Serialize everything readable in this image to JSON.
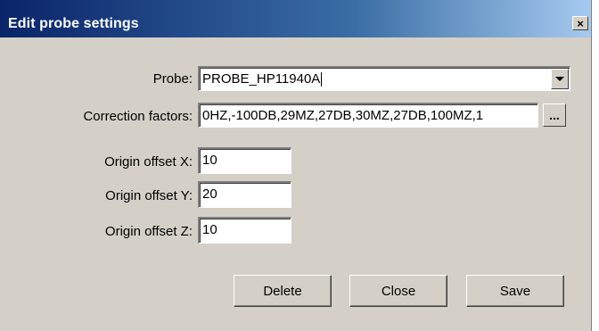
{
  "window": {
    "title": "Edit probe settings",
    "close_glyph": "×",
    "close_icon": "close-icon"
  },
  "form": {
    "probe_label": "Probe:",
    "probe_value": "PROBE_HP11940A",
    "correction_label": "Correction factors:",
    "correction_value": "0HZ,-100DB,29MZ,27DB,30MZ,27DB,100MZ,1",
    "browse_label": "...",
    "offset_x_label": "Origin offset X:",
    "offset_x_value": "10",
    "offset_y_label": "Origin offset Y:",
    "offset_y_value": "20",
    "offset_z_label": "Origin offset Z:",
    "offset_z_value": "10"
  },
  "buttons": {
    "delete": "Delete",
    "close": "Close",
    "save": "Save"
  },
  "colors": {
    "title_gradient_start": "#0a246a",
    "title_gradient_end": "#a6caf0",
    "dialog_bg": "#d4d0c8"
  }
}
